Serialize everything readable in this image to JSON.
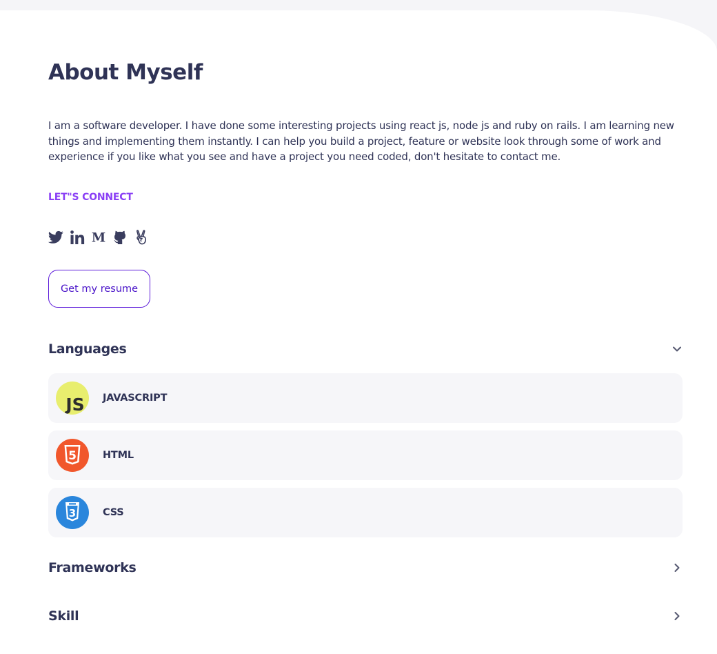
{
  "about": {
    "title": "About Myself",
    "bio": "I am a software developer. I have done some interesting projects using react js, node js and ruby on rails. I am learning new things and implementing them instantly. I can help you build a project, feature or website look through some of work and experience if you like what you see and have a project you need coded, don't hesitate to contact me.",
    "connect_label": "LET\"S CONNECT",
    "socials": [
      {
        "icon": "twitter-icon"
      },
      {
        "icon": "linkedin-icon"
      },
      {
        "icon": "medium-icon"
      },
      {
        "icon": "github-icon"
      },
      {
        "icon": "angellist-icon"
      }
    ],
    "resume_button": "Get my resume"
  },
  "sections": {
    "languages": {
      "title": "Languages",
      "expanded": true,
      "items": [
        {
          "name": "JAVASCRIPT",
          "logo": "javascript-logo",
          "logo_text": "JS",
          "color": "#e8ee6e"
        },
        {
          "name": "HTML",
          "logo": "html5-logo",
          "logo_text": "5",
          "color": "#f1572c"
        },
        {
          "name": "CSS",
          "logo": "css3-logo",
          "logo_text": "3",
          "color": "#2a86dc"
        }
      ]
    },
    "frameworks": {
      "title": "Frameworks",
      "expanded": false
    },
    "skill": {
      "title": "Skill",
      "expanded": false
    }
  },
  "colors": {
    "text": "#2f3356",
    "accent": "#8a3ff5",
    "button_border": "#5a18d9",
    "item_bg": "#f6f6f9",
    "page_bg": "#f5f5f8"
  }
}
